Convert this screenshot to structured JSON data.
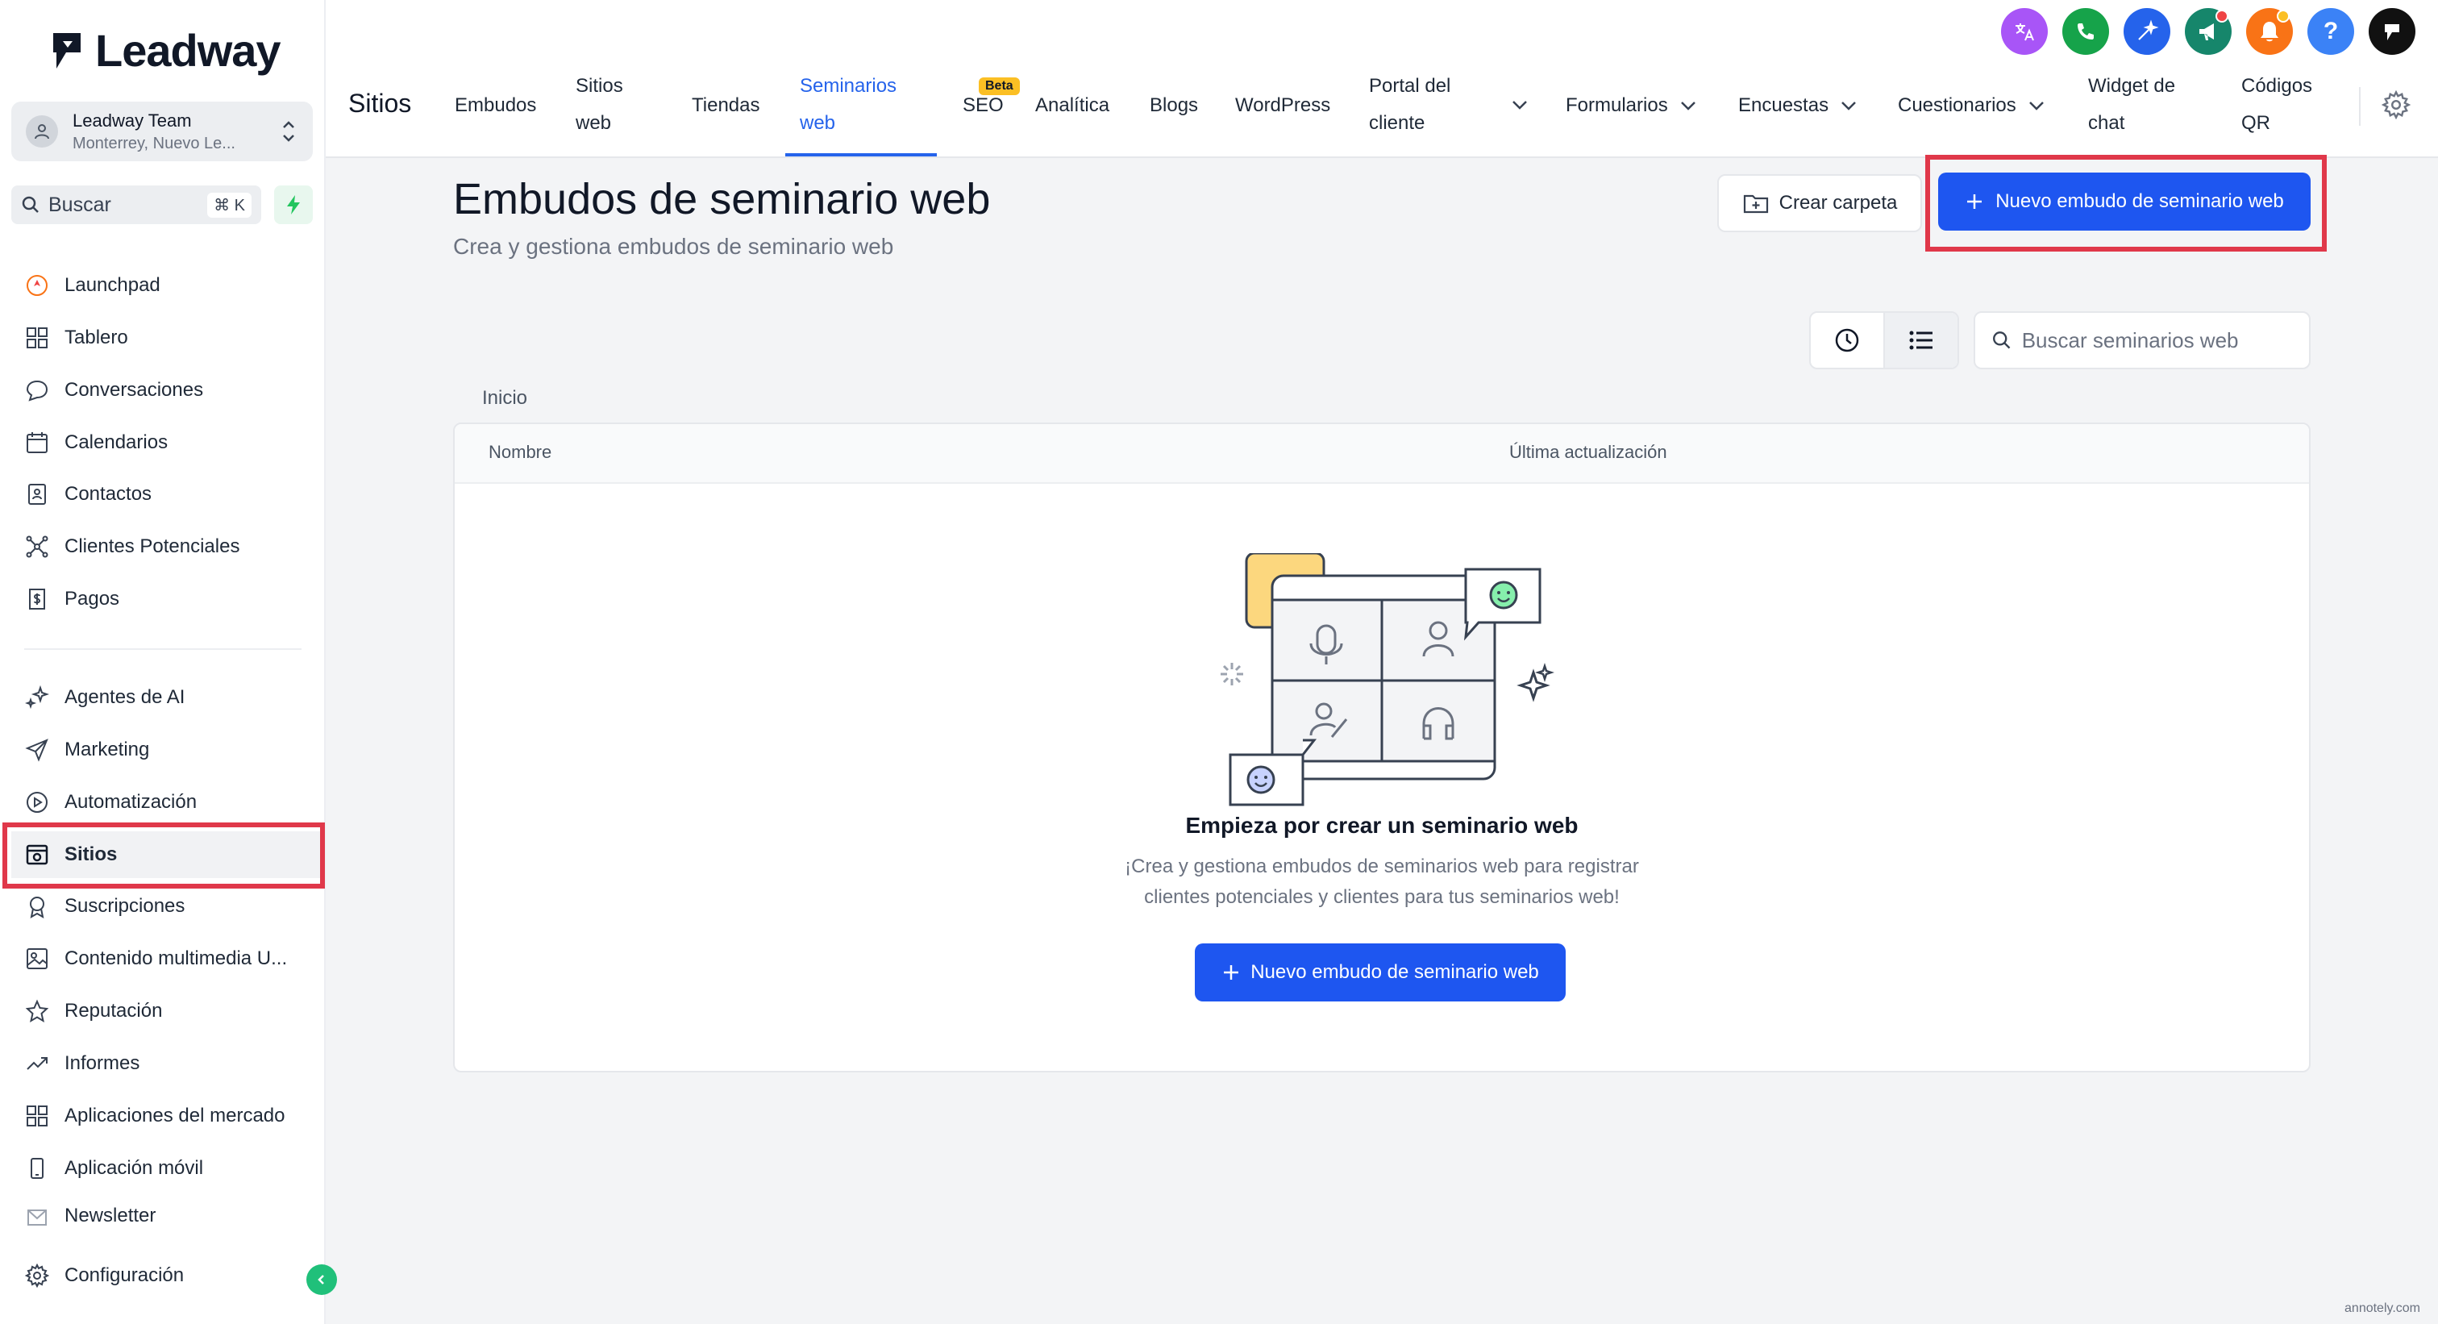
{
  "brand": {
    "name": "Leadway"
  },
  "account": {
    "name": "Leadway Team",
    "location": "Monterrey, Nuevo Le..."
  },
  "sidebar_search": {
    "label": "Buscar",
    "shortcut": "⌘ K"
  },
  "sidebar": {
    "items": [
      {
        "label": "Launchpad",
        "icon": "rocket-icon"
      },
      {
        "label": "Tablero",
        "icon": "grid-icon"
      },
      {
        "label": "Conversaciones",
        "icon": "chat-icon"
      },
      {
        "label": "Calendarios",
        "icon": "calendar-icon"
      },
      {
        "label": "Contactos",
        "icon": "contacts-icon"
      },
      {
        "label": "Clientes Potenciales",
        "icon": "network-icon"
      },
      {
        "label": "Pagos",
        "icon": "invoice-icon"
      },
      {
        "label": "Agentes de AI",
        "icon": "sparkles-icon"
      },
      {
        "label": "Marketing",
        "icon": "send-icon"
      },
      {
        "label": "Automatización",
        "icon": "automation-icon"
      },
      {
        "label": "Sitios",
        "icon": "website-icon",
        "active": true
      },
      {
        "label": "Suscripciones",
        "icon": "badge-icon"
      },
      {
        "label": "Contenido multimedia U...",
        "icon": "image-icon"
      },
      {
        "label": "Reputación",
        "icon": "star-icon"
      },
      {
        "label": "Informes",
        "icon": "trend-icon"
      },
      {
        "label": "Aplicaciones del mercado",
        "icon": "apps-icon"
      },
      {
        "label": "Aplicación móvil",
        "icon": "phone-icon"
      },
      {
        "label": "Newsletter",
        "icon": "newsletter-icon"
      }
    ],
    "settings_label": "Configuración"
  },
  "topbar": {
    "section_title": "Sitios",
    "tabs": [
      {
        "line1": "Embudos",
        "line2": ""
      },
      {
        "line1": "Sitios",
        "line2": "web"
      },
      {
        "line1": "Tiendas",
        "line2": ""
      },
      {
        "line1": "Seminarios",
        "line2": "web"
      },
      {
        "line1": "SEO",
        "line2": ""
      },
      {
        "line1": "Analítica",
        "line2": ""
      },
      {
        "line1": "Blogs",
        "line2": ""
      },
      {
        "line1": "WordPress",
        "line2": ""
      },
      {
        "line1": "Portal del",
        "line2": "cliente"
      },
      {
        "line1": "Formularios",
        "line2": ""
      },
      {
        "line1": "Encuestas",
        "line2": ""
      },
      {
        "line1": "Cuestionarios",
        "line2": ""
      },
      {
        "line1": "Widget de",
        "line2": "chat"
      },
      {
        "line1": "Códigos",
        "line2": "QR"
      }
    ],
    "beta_badge": "Beta",
    "icon_colors": {
      "translate": "#a855f7",
      "phone": "#16a34a",
      "magic": "#2563eb",
      "megaphone": "#16866b",
      "bell": "#f97316",
      "help": "#3b82f6",
      "brand": "#111111"
    }
  },
  "main": {
    "title": "Embudos de seminario web",
    "subtitle": "Crea y gestiona embudos de seminario web",
    "create_folder": "Crear carpeta",
    "new_funnel": "Nuevo embudo de seminario web",
    "search_placeholder": "Buscar seminarios web",
    "breadcrumb": "Inicio",
    "table": {
      "columns": [
        "Nombre",
        "Última actualización"
      ]
    },
    "empty_state": {
      "title": "Empieza por crear un seminario web",
      "description_line1": "¡Crea y gestiona embudos de seminarios web para registrar",
      "description_line2": "clientes potenciales y clientes para tus seminarios web!",
      "button": "Nuevo embudo de seminario web"
    }
  },
  "watermark": "annotely.com",
  "colors": {
    "accent": "#1e56f0",
    "highlight": "#e0384a",
    "active_tab": "#2563eb"
  }
}
